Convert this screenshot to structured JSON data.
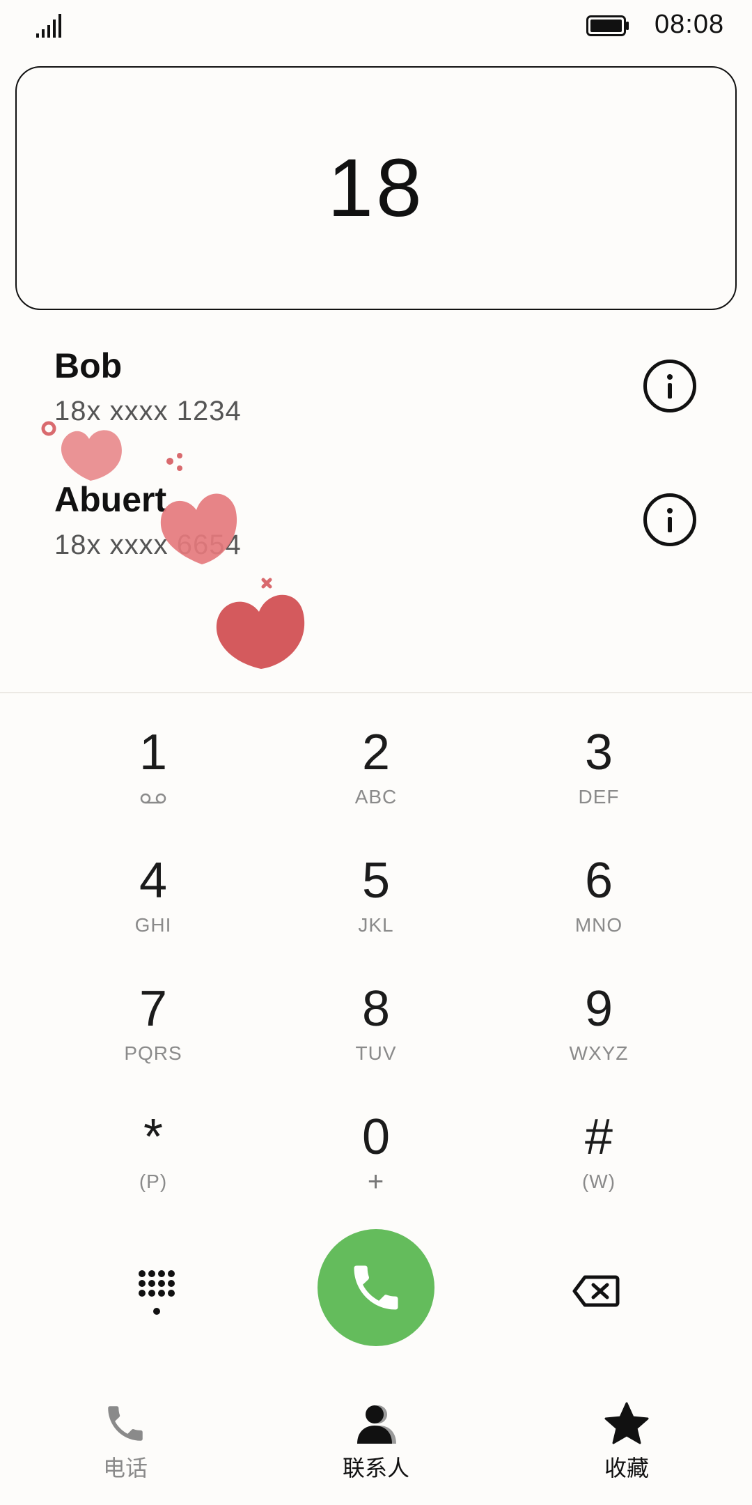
{
  "status_bar": {
    "time": "08:08"
  },
  "dial_display": {
    "number": "18"
  },
  "suggestions": [
    {
      "name": "Bob",
      "number": "18x xxxx 1234"
    },
    {
      "name": "Abuert",
      "number": "18x xxxx 6654"
    }
  ],
  "keypad": [
    {
      "digit": "1",
      "letters": ""
    },
    {
      "digit": "2",
      "letters": "ABC"
    },
    {
      "digit": "3",
      "letters": "DEF"
    },
    {
      "digit": "4",
      "letters": "GHI"
    },
    {
      "digit": "5",
      "letters": "JKL"
    },
    {
      "digit": "6",
      "letters": "MNO"
    },
    {
      "digit": "7",
      "letters": "PQRS"
    },
    {
      "digit": "8",
      "letters": "TUV"
    },
    {
      "digit": "9",
      "letters": "WXYZ"
    },
    {
      "digit": "*",
      "letters": "(P)"
    },
    {
      "digit": "0",
      "letters": "+"
    },
    {
      "digit": "#",
      "letters": "(W)"
    }
  ],
  "bottom_nav": [
    {
      "label": "电话",
      "icon": "phone-icon",
      "active": false
    },
    {
      "label": "联系人",
      "icon": "contacts-icon",
      "active": true
    },
    {
      "label": "收藏",
      "icon": "star-icon",
      "active": false
    }
  ],
  "colors": {
    "call_button": "#64bc5c",
    "heart": "#d96a6e",
    "background": "#fdfcfa"
  }
}
